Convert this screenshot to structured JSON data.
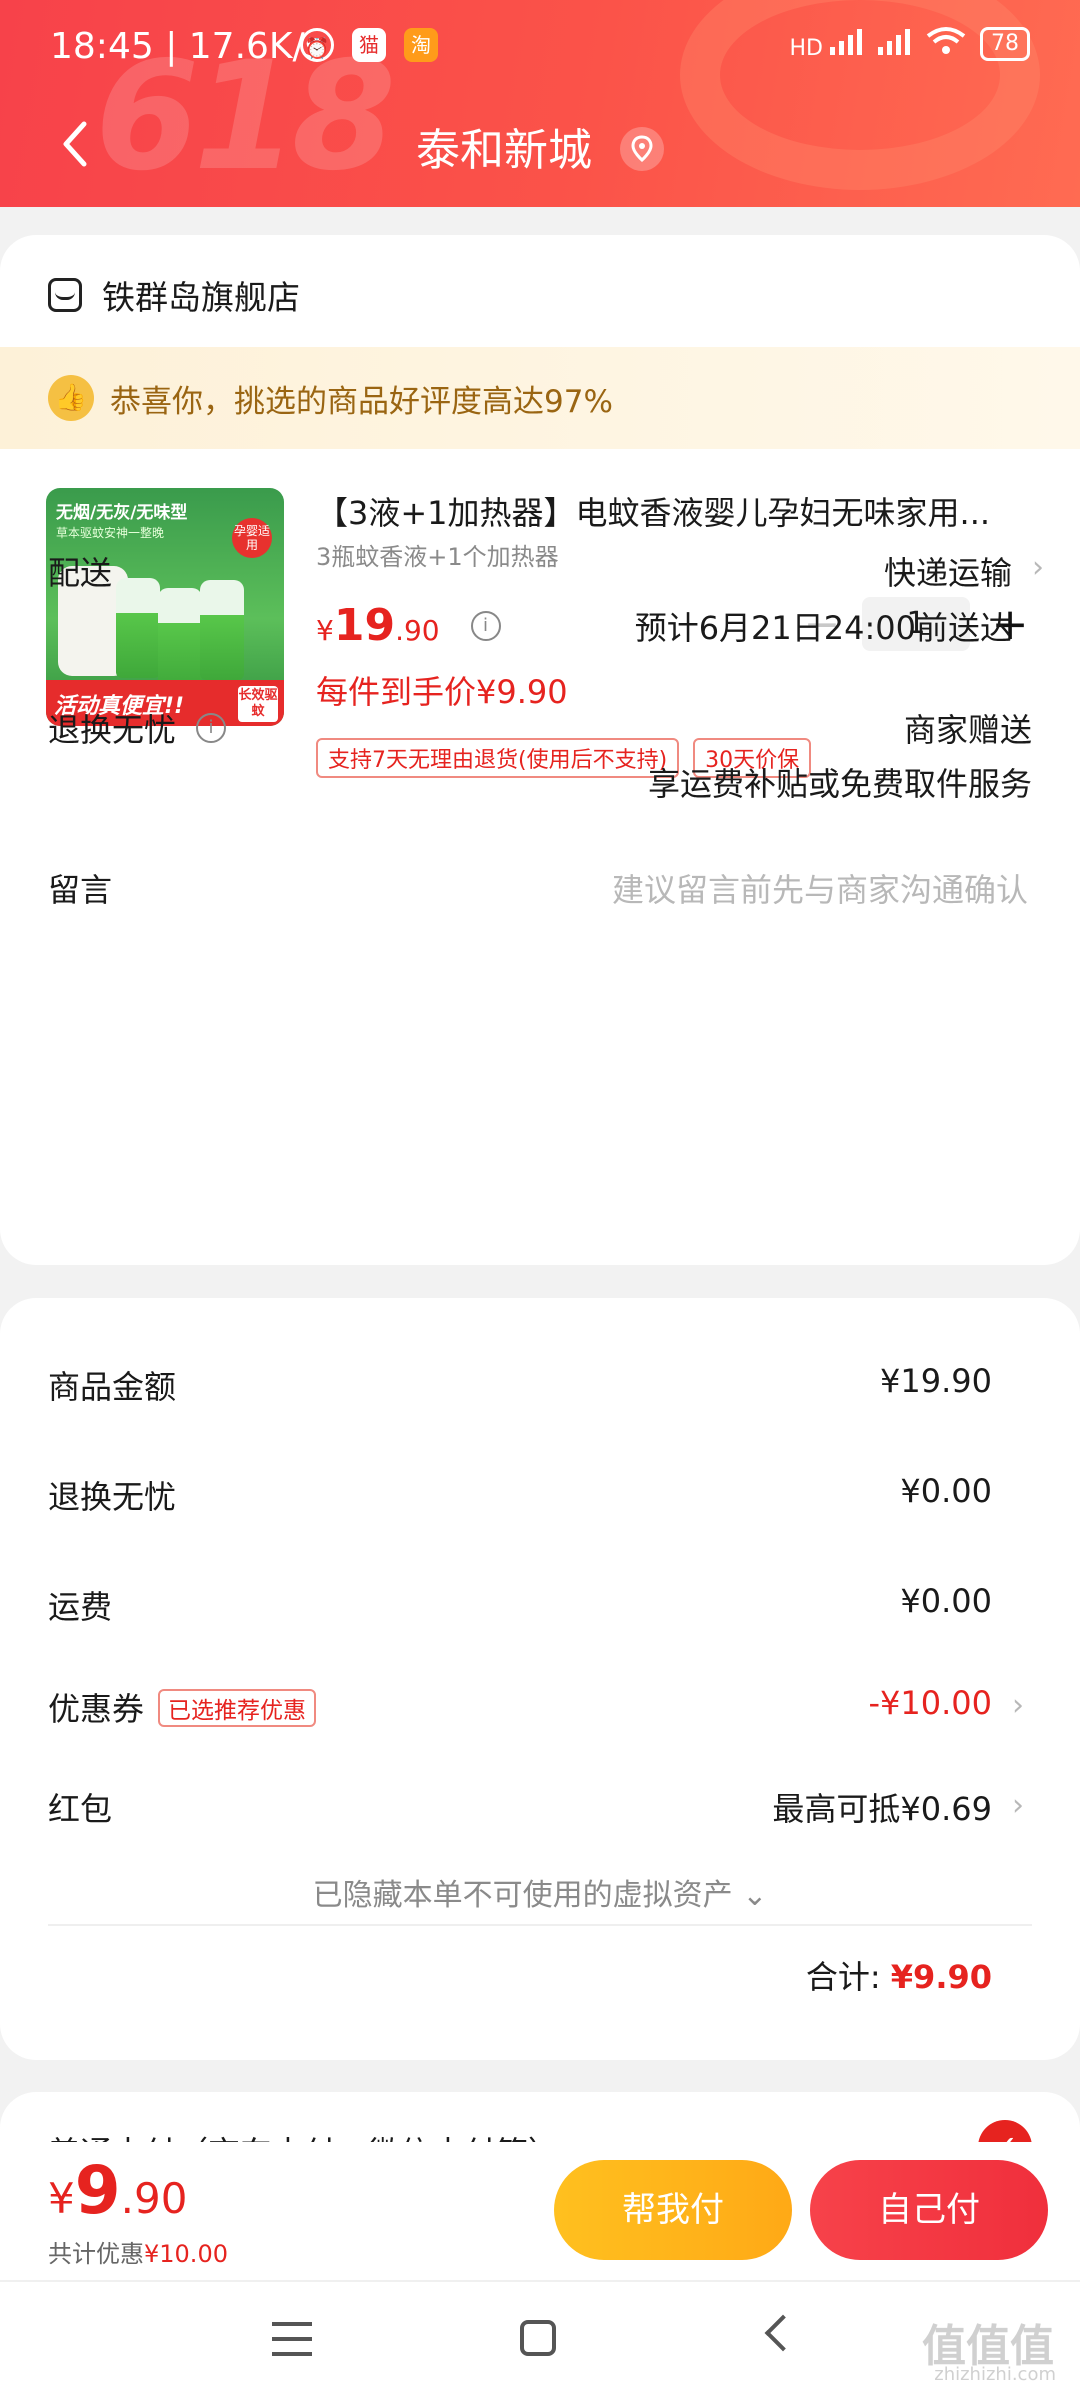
{
  "status_bar": {
    "time": "18:45 | 17.6K/s",
    "signal": "HD",
    "battery": "78"
  },
  "header": {
    "bg_text": "618",
    "title": "泰和新城"
  },
  "shop": {
    "name": "铁群岛旗舰店"
  },
  "praise_banner": {
    "text": "恭喜你，挑选的商品好评度高达97%"
  },
  "product": {
    "image_top": "无烟/无灰/无味型",
    "image_sub": "草本驱蚊安神一整晚",
    "image_badge": "孕婴适用",
    "image_strip": "活动真便宜!!",
    "image_tag": "长效驱蚊",
    "title": "【3液+1加热器】电蚊香液婴儿孕妇无味家用...",
    "spec": "3瓶蚊香液+1个加热器",
    "price_symbol": "¥",
    "price_int": "19",
    "price_dec": ".90",
    "net_price": "每件到手价¥9.90",
    "quantity": "1",
    "tags": [
      "支持7天无理由退货(使用后不支持)",
      "30天价保"
    ]
  },
  "delivery": {
    "label": "配送",
    "method": "快递运输",
    "eta": "预计6月21日24:00前送达"
  },
  "return_worry_free": {
    "label": "退换无忧",
    "line1": "商家赠送",
    "line2": "享运费补贴或免费取件服务"
  },
  "message": {
    "label": "留言",
    "placeholder": "建议留言前先与商家沟通确认"
  },
  "summary": {
    "goods_label": "商品金额",
    "goods_value": "¥19.90",
    "return_label": "退换无忧",
    "return_value": "¥0.00",
    "shipping_label": "运费",
    "shipping_value": "¥0.00",
    "coupon_label": "优惠券",
    "coupon_tag": "已选推荐优惠",
    "coupon_value": "-¥10.00",
    "redpacket_label": "红包",
    "redpacket_value": "最高可抵¥0.69",
    "hidden_assets": "已隐藏本单不可使用的虚拟资产 ⌄",
    "total_label": "合计:",
    "total_value": "¥9.90"
  },
  "payment": {
    "method": "普通支付（京东支付、微信支付等）"
  },
  "action_bar": {
    "price_symbol": "¥",
    "price_int": "9",
    "price_dec": ".90",
    "discount_label": "共计优惠",
    "discount_value": "¥10.00",
    "help_pay": "帮我付",
    "self_pay": "自己付"
  },
  "watermark": {
    "mark": "值值值",
    "site": "zhizhizhi.com"
  },
  "colors": {
    "accent_red": "#e6231f",
    "header_red": "#f7424a",
    "help_btn": "#ffb21a",
    "praise_bg": "#fdf1d8"
  }
}
